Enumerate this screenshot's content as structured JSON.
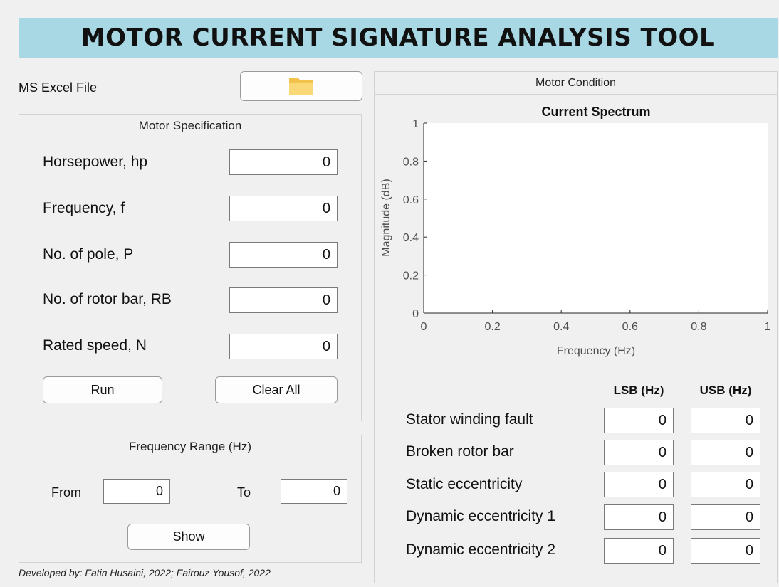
{
  "header": {
    "title": "MOTOR CURRENT SIGNATURE ANALYSIS TOOL"
  },
  "file": {
    "label": "MS Excel File",
    "browse_icon": "folder-icon"
  },
  "spec": {
    "title": "Motor Specification",
    "fields": [
      {
        "label": "Horsepower, hp",
        "value": "0"
      },
      {
        "label": "Frequency, f",
        "value": "0"
      },
      {
        "label": "No. of pole, P",
        "value": "0"
      },
      {
        "label": "No. of rotor bar, RB",
        "value": "0"
      },
      {
        "label": "Rated speed, N",
        "value": "0"
      }
    ],
    "run_label": "Run",
    "clear_label": "Clear All"
  },
  "range": {
    "title": "Frequency Range (Hz)",
    "from_label": "From",
    "from_value": "0",
    "to_label": "To",
    "to_value": "0",
    "show_label": "Show"
  },
  "footer": {
    "credit": "Developed by: Fatin Husaini, 2022; Fairouz Yousof, 2022"
  },
  "condition": {
    "title": "Motor Condition",
    "lsb_header": "LSB (Hz)",
    "usb_header": "USB (Hz)",
    "rows": [
      {
        "label": "Stator winding fault",
        "lsb": "0",
        "usb": "0"
      },
      {
        "label": "Broken rotor bar",
        "lsb": "0",
        "usb": "0"
      },
      {
        "label": "Static eccentricity",
        "lsb": "0",
        "usb": "0"
      },
      {
        "label": "Dynamic eccentricity 1",
        "lsb": "0",
        "usb": "0"
      },
      {
        "label": "Dynamic eccentricity 2",
        "lsb": "0",
        "usb": "0"
      }
    ]
  },
  "chart_data": {
    "type": "line",
    "title": "Current Spectrum",
    "xlabel": "Frequency (Hz)",
    "ylabel": "Magnitude (dB)",
    "xlim": [
      0,
      1
    ],
    "ylim": [
      0,
      1
    ],
    "xticks": [
      "0",
      "0.2",
      "0.4",
      "0.6",
      "0.8",
      "1"
    ],
    "yticks": [
      "0",
      "0.2",
      "0.4",
      "0.6",
      "0.8",
      "1"
    ],
    "grid": false,
    "series": []
  }
}
